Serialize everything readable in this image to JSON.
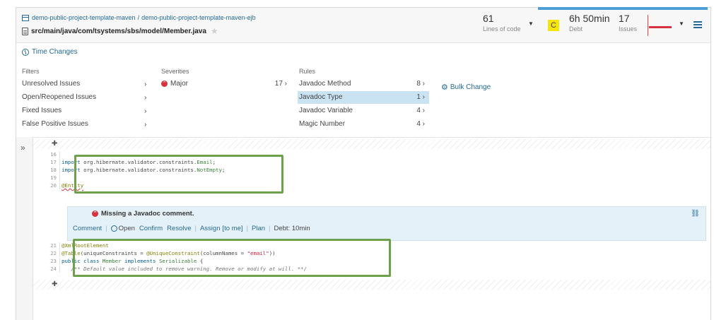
{
  "header": {
    "project": "demo-public-project-template-maven",
    "path_sep": "/",
    "module": "demo-public-project-template-maven-ejb",
    "file_path": "src/main/java/com/tsystems/sbs/model/",
    "file_name": "Member.java",
    "lines_value": "61",
    "lines_label": "Lines of code",
    "debt_rating": "C",
    "debt_value": "6h 50min",
    "debt_label": "Debt",
    "issues_value": "17",
    "issues_label": "Issues",
    "colors": {
      "accent": "#236a97",
      "top_bar": "#4b9fd5",
      "rating_c": "#f4e60c",
      "major": "#d4333f",
      "highlight_box": "#6ea14b"
    }
  },
  "time_changes": "Time Changes",
  "filters": {
    "heading": "Filters",
    "items": [
      "Unresolved Issues",
      "Open/Reopened Issues",
      "Fixed Issues",
      "False Positive Issues"
    ]
  },
  "severities": {
    "heading": "Severities",
    "items": [
      {
        "label": "Major",
        "count": "17"
      }
    ]
  },
  "rules": {
    "heading": "Rules",
    "items": [
      {
        "label": "Javadoc Method",
        "count": "8"
      },
      {
        "label": "Javadoc Type",
        "count": "1",
        "selected": true
      },
      {
        "label": "Javadoc Variable",
        "count": "4"
      },
      {
        "label": "Magic Number",
        "count": "4"
      }
    ]
  },
  "bulk_change": "Bulk Change",
  "side_toggle": "»",
  "code": {
    "lines": [
      {
        "n": "16",
        "t": ""
      },
      {
        "n": "17",
        "t": "import org.hibernate.validator.constraints.Email;"
      },
      {
        "n": "18",
        "t": "import org.hibernate.validator.constraints.NotEmpty;"
      },
      {
        "n": "19",
        "t": ""
      },
      {
        "n": "20",
        "t": "@Entity"
      },
      {
        "n": "21",
        "t": "@XmlRootElement"
      },
      {
        "n": "22",
        "t": "@Table(uniqueConstraints = @UniqueConstraint(columnNames = \"email\"))"
      },
      {
        "n": "23",
        "t": "public class Member implements Serializable {"
      },
      {
        "n": "24",
        "t": "   /** Default value included to remove warning. Remove or modify at will. **/"
      }
    ]
  },
  "issue": {
    "title": "Missing a Javadoc comment.",
    "comment": "Comment",
    "status": "Open",
    "confirm": "Confirm",
    "resolve": "Resolve",
    "assign": "Assign",
    "assign_me": "[to me]",
    "plan": "Plan",
    "debt": "Debt: 10min"
  }
}
